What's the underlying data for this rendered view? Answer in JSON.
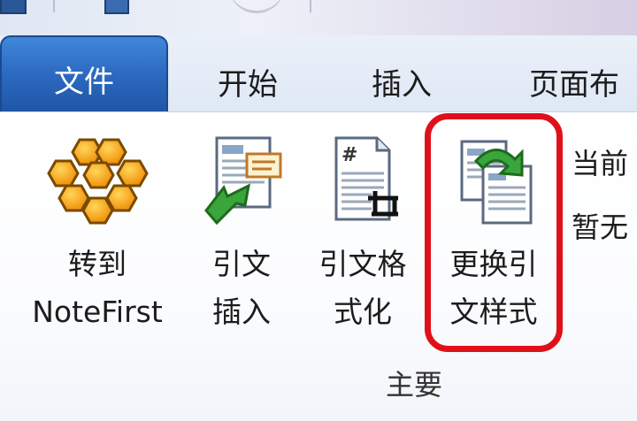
{
  "tabs": {
    "file": "文件",
    "home": "开始",
    "insert": "插入",
    "layout": "页面布"
  },
  "ribbon": {
    "group_label": "主要",
    "buttons": [
      {
        "line1": "转到",
        "line2": "NoteFirst",
        "icon": "honeycomb-icon"
      },
      {
        "line1": "引文",
        "line2": "插入",
        "icon": "insert-citation-icon"
      },
      {
        "line1": "引文格",
        "line2": "式化",
        "icon": "format-citation-icon"
      },
      {
        "line1": "更换引",
        "line2": "文样式",
        "icon": "change-style-icon"
      }
    ],
    "side_items": [
      "当前",
      "暂无"
    ]
  },
  "colors": {
    "file_tab": "#2a66bd",
    "highlight": "#e0101a",
    "honeycomb": "#f5a316",
    "arrow_green": "#3aa53a"
  }
}
